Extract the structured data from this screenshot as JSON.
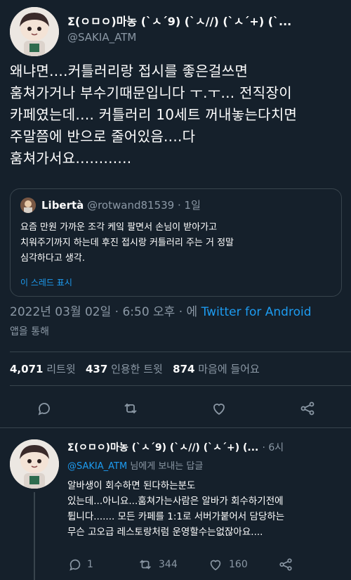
{
  "tweet": {
    "display_name": "Σ(ㅇㅁㅇ)마농 (`ㅅ´9) (`ㅅ//) (`ㅅ´+) (`...",
    "handle": "@SAKIA_ATM",
    "text_lines": [
      "왜냐면....커틀러리랑 접시를 좋은걸쓰면",
      "훔쳐가거나 부수기때문입니다 ㅜ.ㅜ... 전직장이",
      "카페였는데.... 커틀러리 10세트 꺼내놓는다치면",
      "주말쯤에 반으로 줄어있음....다",
      "훔쳐가서요............"
    ],
    "quote": {
      "name": "Libertà",
      "handle": "@rotwand81539",
      "time": "· 1일",
      "text_lines": [
        "요즘 만원 가까운 조각 케잌 팔면서 손님이 받아가고",
        "치워주기까지 하는데 후진 접시랑 커틀러리 주는 거 정말",
        "심각하다고 생각."
      ],
      "show_thread": "이 스레드 표시"
    },
    "timestamp": "2022년 03월 02일 · 6:50 오후 · 에",
    "source": "Twitter for Android",
    "source_suffix": "앱을 통해",
    "stats": {
      "retweets_count": "4,071",
      "retweets_label": "리트윗",
      "quotes_count": "437",
      "quotes_label": "인용한 트윗",
      "likes_count": "874",
      "likes_label": "마음에 들어요"
    },
    "actions": [
      "reply-icon",
      "retweet-icon",
      "like-icon",
      "share-icon"
    ]
  },
  "reply": {
    "display_name": "Σ(ㅇㅁㅇ)마농 (`ㅅ´9) (`ㅅ//) (`ㅅ´+) (...",
    "time": "· 6시",
    "replying_to": "@SAKIA_ATM",
    "replying_suffix": "님에게 보내는 답글",
    "text_lines": [
      "알바생이 회수하면 된다하는분도",
      "있는데...아니요...훔쳐가는사람은 알바가 회수하기전에",
      "튑니다....... 모든 카페를 1:1로 서버가붙어서 담당하는",
      "무슨 고오급 레스토랑처럼 운영할수는없잖아요...."
    ],
    "reply_count": "1",
    "retweet_count": "344",
    "like_count": "160"
  },
  "colors": {
    "background": "#15202b",
    "accent": "#1d9bf0",
    "muted": "#8b98a5",
    "divider": "#38444d"
  }
}
